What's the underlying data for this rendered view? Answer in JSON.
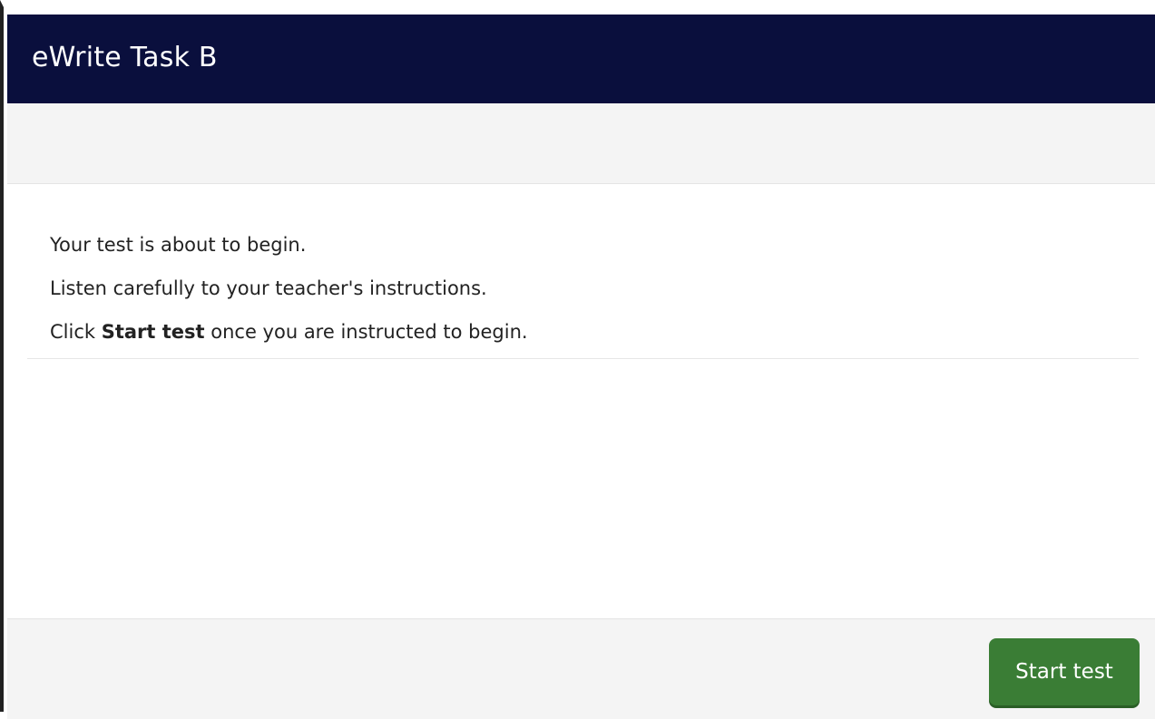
{
  "header": {
    "title": "eWrite Task B"
  },
  "instructions": {
    "line1": "Your test is about to begin.",
    "line2": "Listen carefully to your teacher's instructions.",
    "line3_prefix": "Click ",
    "line3_bold": "Start test",
    "line3_suffix": " once you are instructed to begin."
  },
  "footer": {
    "start_button_label": "Start test"
  },
  "colors": {
    "header_bg": "#0a0f3d",
    "button_bg": "#3a7d35"
  }
}
